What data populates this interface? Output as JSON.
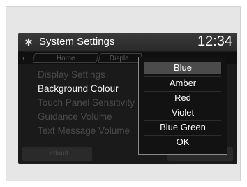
{
  "header": {
    "title": "System Settings",
    "clock": "12:34"
  },
  "tabs": [
    {
      "label": "Home"
    },
    {
      "label": "Displa"
    }
  ],
  "menu": {
    "items": [
      {
        "label": "Display Settings"
      },
      {
        "label": "Background Colour"
      },
      {
        "label": "Touch Panel Sensitivity"
      },
      {
        "label": "Guidance Volume"
      },
      {
        "label": "Text Message Volume"
      }
    ]
  },
  "footer": {
    "default_label": "Default"
  },
  "popup": {
    "options": [
      {
        "label": "Blue"
      },
      {
        "label": "Amber"
      },
      {
        "label": "Red"
      },
      {
        "label": "Violet"
      },
      {
        "label": "Blue Green"
      },
      {
        "label": "OK"
      }
    ]
  },
  "icons": {
    "header": "gear-icon",
    "back": "chevron-left-icon"
  },
  "colors": {
    "screen_background": "#1a1a1a",
    "selected_option": "#4b4b4b"
  }
}
